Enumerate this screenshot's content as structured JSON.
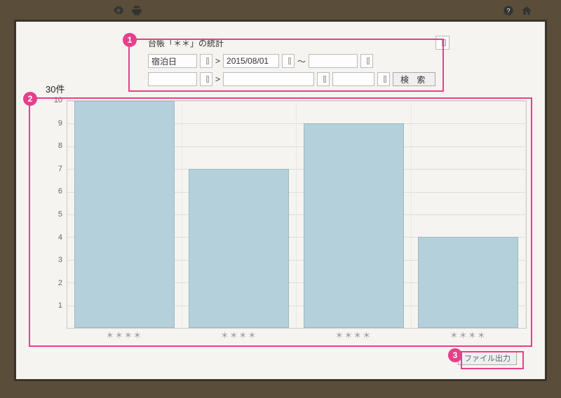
{
  "toolbar": {
    "gear": "⚙",
    "print": "🖶",
    "help": "?",
    "home": "🏠"
  },
  "filters": {
    "title": "台帳「＊＊」の統計",
    "field1_label": "宿泊日",
    "gt": ">",
    "date": "2015/08/01",
    "tilde": "～",
    "search_label": "検 索"
  },
  "count_text": "30件",
  "callouts": {
    "c1": "1",
    "c2": "2",
    "c3": "3"
  },
  "export_label": "ファイル出力",
  "chart_data": {
    "type": "bar",
    "categories": [
      "＊＊＊＊",
      "＊＊＊＊",
      "＊＊＊＊",
      "＊＊＊＊"
    ],
    "values": [
      10,
      7,
      9,
      4
    ],
    "title": "",
    "xlabel": "",
    "ylabel": "",
    "ylim": [
      0,
      10
    ],
    "yticks": [
      1,
      2,
      3,
      4,
      5,
      6,
      7,
      8,
      9,
      10
    ]
  }
}
